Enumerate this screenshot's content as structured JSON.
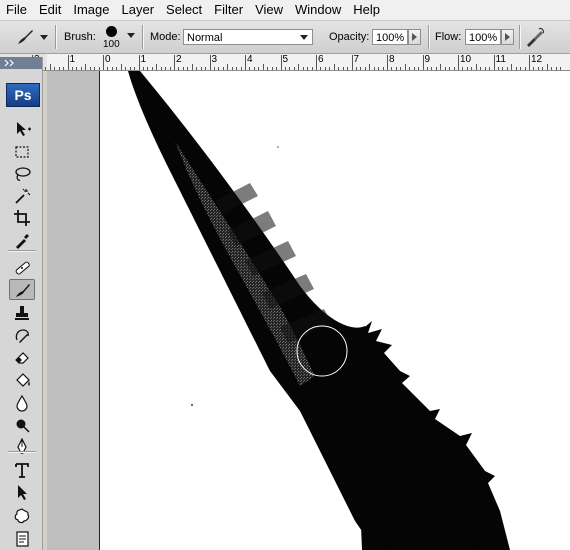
{
  "menu": [
    "File",
    "Edit",
    "Image",
    "Layer",
    "Select",
    "Filter",
    "View",
    "Window",
    "Help"
  ],
  "options": {
    "brush_label": "Brush:",
    "brush_size": "100",
    "mode_label": "Mode:",
    "mode_value": "Normal",
    "opacity_label": "Opacity:",
    "opacity_value": "100%",
    "flow_label": "Flow:",
    "flow_value": "100%"
  },
  "ruler": {
    "labels": [
      "2",
      "1",
      "0",
      "1",
      "2",
      "3",
      "4",
      "5",
      "6",
      "7",
      "8",
      "9",
      "10",
      "11",
      "12"
    ]
  },
  "toolbar": {
    "logo": "Ps",
    "tools": [
      "move-icon",
      "marquee-icon",
      "lasso-icon",
      "magic-wand-icon",
      "crop-icon",
      "eyedropper-icon",
      "healing-brush-icon",
      "brush-icon",
      "clone-stamp-icon",
      "history-brush-icon",
      "eraser-icon",
      "paint-bucket-icon",
      "blur-icon",
      "dodge-icon",
      "pen-icon",
      "type-icon",
      "path-selection-icon",
      "custom-shape-icon",
      "notes-icon"
    ],
    "active_tool": "brush-icon"
  },
  "colors": {
    "ps_blue": "#1f4f9c",
    "canvas": "#ffffff",
    "stroke": "#000000"
  }
}
